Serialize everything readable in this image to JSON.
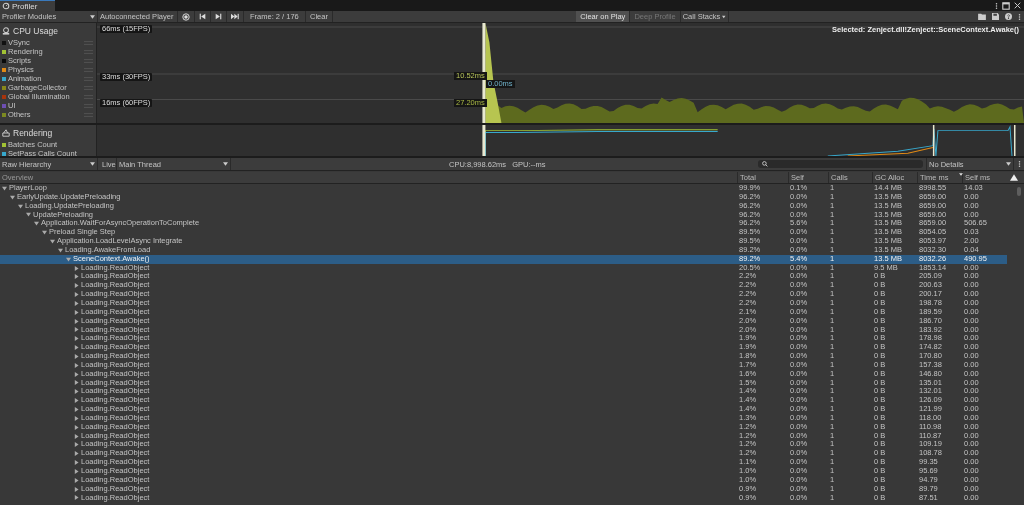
{
  "window": {
    "tab": "Profiler"
  },
  "toolbar": {
    "modules_dropdown": "Profiler Modules",
    "target": "Autoconnected Player",
    "frame": "Frame: 2 / 176",
    "clear": "Clear",
    "clear_on_play": {
      "label": "Clear on Play",
      "on": true
    },
    "deep_profile": {
      "label": "Deep Profile",
      "disabled": true
    },
    "call_stacks": "Call Stacks"
  },
  "modules": [
    {
      "title": "CPU Usage",
      "kind": "cpu",
      "legend": [
        {
          "name": "VSync",
          "color": "#111111"
        },
        {
          "name": "Rendering",
          "color": "#a1c234"
        },
        {
          "name": "Scripts",
          "color": "#0a0a0a"
        },
        {
          "name": "Physics",
          "color": "#e38a14"
        },
        {
          "name": "Animation",
          "color": "#37a8cc"
        },
        {
          "name": "GarbageCollector",
          "color": "#88881a"
        },
        {
          "name": "Global Illumination",
          "color": "#a8340c"
        },
        {
          "name": "UI",
          "color": "#6e4fb4"
        },
        {
          "name": "Others",
          "color": "#7c8a21"
        }
      ],
      "markers": [
        "66ms (15FPS)",
        "33ms (30FPS)",
        "16ms (60FPS)"
      ],
      "readings": [
        "10.52ms",
        "0.00ms",
        "27.20ms"
      ]
    },
    {
      "title": "Rendering",
      "kind": "rendering",
      "legend": [
        {
          "name": "Batches Count",
          "color": "#a1c234"
        },
        {
          "name": "SetPass Calls Count",
          "color": "#37a8cc"
        }
      ]
    }
  ],
  "selected_label": "Selected: Zenject.dll!Zenject::SceneContext.Awake()",
  "hierarchy_toolbar": {
    "view": "Raw Hierarchy",
    "live": "Live",
    "thread": "Main Thread",
    "cpu": "CPU:8,998.62ms",
    "gpu": "GPU:--ms",
    "details": "No Details"
  },
  "table": {
    "tree_column": "Overview",
    "columns": [
      "Total",
      "Self",
      "Calls",
      "GC Alloc",
      "Time ms",
      "Self ms"
    ],
    "rows": [
      {
        "name": "PlayerLoop",
        "cells": [
          "99.9%",
          "0.1%",
          "1",
          "14.4 MB",
          "8998.55",
          "14.03"
        ],
        "expanded": true,
        "selected": false,
        "children": [
          {
            "name": "EarlyUpdate.UpdatePreloading",
            "cells": [
              "96.2%",
              "0.0%",
              "1",
              "13.5 MB",
              "8659.00",
              "0.00"
            ],
            "expanded": true,
            "selected": false,
            "children": [
              {
                "name": "Loading.UpdatePreloading",
                "cells": [
                  "96.2%",
                  "0.0%",
                  "1",
                  "13.5 MB",
                  "8659.00",
                  "0.00"
                ],
                "expanded": true,
                "selected": false,
                "children": [
                  {
                    "name": "UpdatePreloading",
                    "cells": [
                      "96.2%",
                      "0.0%",
                      "1",
                      "13.5 MB",
                      "8659.00",
                      "0.00"
                    ],
                    "expanded": true,
                    "selected": false,
                    "children": [
                      {
                        "name": "Application.WaitForAsyncOperationToComplete",
                        "cells": [
                          "96.2%",
                          "5.6%",
                          "1",
                          "13.5 MB",
                          "8659.00",
                          "506.65"
                        ],
                        "expanded": true,
                        "selected": false,
                        "children": [
                          {
                            "name": "Preload Single Step",
                            "cells": [
                              "89.5%",
                              "0.0%",
                              "1",
                              "13.5 MB",
                              "8054.05",
                              "0.03"
                            ],
                            "expanded": true,
                            "selected": false,
                            "children": [
                              {
                                "name": "Application.LoadLevelAsync Integrate",
                                "cells": [
                                  "89.5%",
                                  "0.0%",
                                  "1",
                                  "13.5 MB",
                                  "8053.97",
                                  "2.00"
                                ],
                                "expanded": true,
                                "selected": false,
                                "children": [
                                  {
                                    "name": "Loading.AwakeFromLoad",
                                    "cells": [
                                      "89.2%",
                                      "0.0%",
                                      "1",
                                      "13.5 MB",
                                      "8032.30",
                                      "0.04"
                                    ],
                                    "expanded": true,
                                    "selected": false,
                                    "children": [
                                      {
                                        "name": "SceneContext.Awake()",
                                        "cells": [
                                          "89.2%",
                                          "5.4%",
                                          "1",
                                          "13.5 MB",
                                          "8032.26",
                                          "490.95"
                                        ],
                                        "expanded": true,
                                        "selected": true,
                                        "children": [
                                          {
                                            "name": "Loading.ReadObject",
                                            "cells": [
                                              "20.5%",
                                              "0.0%",
                                              "1",
                                              "9.5 MB",
                                              "1853.14",
                                              "0.00"
                                            ],
                                            "expanded": false,
                                            "selected": false
                                          },
                                          {
                                            "name": "Loading.ReadObject",
                                            "cells": [
                                              "2.2%",
                                              "0.0%",
                                              "1",
                                              "0 B",
                                              "205.09",
                                              "0.00"
                                            ],
                                            "expanded": false,
                                            "selected": false
                                          },
                                          {
                                            "name": "Loading.ReadObject",
                                            "cells": [
                                              "2.2%",
                                              "0.0%",
                                              "1",
                                              "0 B",
                                              "200.63",
                                              "0.00"
                                            ],
                                            "expanded": false,
                                            "selected": false
                                          },
                                          {
                                            "name": "Loading.ReadObject",
                                            "cells": [
                                              "2.2%",
                                              "0.0%",
                                              "1",
                                              "0 B",
                                              "200.17",
                                              "0.00"
                                            ],
                                            "expanded": false,
                                            "selected": false
                                          },
                                          {
                                            "name": "Loading.ReadObject",
                                            "cells": [
                                              "2.2%",
                                              "0.0%",
                                              "1",
                                              "0 B",
                                              "198.78",
                                              "0.00"
                                            ],
                                            "expanded": false,
                                            "selected": false
                                          },
                                          {
                                            "name": "Loading.ReadObject",
                                            "cells": [
                                              "2.1%",
                                              "0.0%",
                                              "1",
                                              "0 B",
                                              "189.59",
                                              "0.00"
                                            ],
                                            "expanded": false,
                                            "selected": false
                                          },
                                          {
                                            "name": "Loading.ReadObject",
                                            "cells": [
                                              "2.0%",
                                              "0.0%",
                                              "1",
                                              "0 B",
                                              "186.70",
                                              "0.00"
                                            ],
                                            "expanded": false,
                                            "selected": false
                                          },
                                          {
                                            "name": "Loading.ReadObject",
                                            "cells": [
                                              "2.0%",
                                              "0.0%",
                                              "1",
                                              "0 B",
                                              "183.92",
                                              "0.00"
                                            ],
                                            "expanded": false,
                                            "selected": false
                                          },
                                          {
                                            "name": "Loading.ReadObject",
                                            "cells": [
                                              "1.9%",
                                              "0.0%",
                                              "1",
                                              "0 B",
                                              "178.98",
                                              "0.00"
                                            ],
                                            "expanded": false,
                                            "selected": false
                                          },
                                          {
                                            "name": "Loading.ReadObject",
                                            "cells": [
                                              "1.9%",
                                              "0.0%",
                                              "1",
                                              "0 B",
                                              "174.82",
                                              "0.00"
                                            ],
                                            "expanded": false,
                                            "selected": false
                                          },
                                          {
                                            "name": "Loading.ReadObject",
                                            "cells": [
                                              "1.8%",
                                              "0.0%",
                                              "1",
                                              "0 B",
                                              "170.80",
                                              "0.00"
                                            ],
                                            "expanded": false,
                                            "selected": false
                                          },
                                          {
                                            "name": "Loading.ReadObject",
                                            "cells": [
                                              "1.7%",
                                              "0.0%",
                                              "1",
                                              "0 B",
                                              "157.38",
                                              "0.00"
                                            ],
                                            "expanded": false,
                                            "selected": false
                                          },
                                          {
                                            "name": "Loading.ReadObject",
                                            "cells": [
                                              "1.6%",
                                              "0.0%",
                                              "1",
                                              "0 B",
                                              "146.80",
                                              "0.00"
                                            ],
                                            "expanded": false,
                                            "selected": false
                                          },
                                          {
                                            "name": "Loading.ReadObject",
                                            "cells": [
                                              "1.5%",
                                              "0.0%",
                                              "1",
                                              "0 B",
                                              "135.01",
                                              "0.00"
                                            ],
                                            "expanded": false,
                                            "selected": false
                                          },
                                          {
                                            "name": "Loading.ReadObject",
                                            "cells": [
                                              "1.4%",
                                              "0.0%",
                                              "1",
                                              "0 B",
                                              "132.01",
                                              "0.00"
                                            ],
                                            "expanded": false,
                                            "selected": false
                                          },
                                          {
                                            "name": "Loading.ReadObject",
                                            "cells": [
                                              "1.4%",
                                              "0.0%",
                                              "1",
                                              "0 B",
                                              "126.09",
                                              "0.00"
                                            ],
                                            "expanded": false,
                                            "selected": false
                                          },
                                          {
                                            "name": "Loading.ReadObject",
                                            "cells": [
                                              "1.4%",
                                              "0.0%",
                                              "1",
                                              "0 B",
                                              "121.99",
                                              "0.00"
                                            ],
                                            "expanded": false,
                                            "selected": false
                                          },
                                          {
                                            "name": "Loading.ReadObject",
                                            "cells": [
                                              "1.3%",
                                              "0.0%",
                                              "1",
                                              "0 B",
                                              "118.00",
                                              "0.00"
                                            ],
                                            "expanded": false,
                                            "selected": false
                                          },
                                          {
                                            "name": "Loading.ReadObject",
                                            "cells": [
                                              "1.2%",
                                              "0.0%",
                                              "1",
                                              "0 B",
                                              "110.98",
                                              "0.00"
                                            ],
                                            "expanded": false,
                                            "selected": false
                                          },
                                          {
                                            "name": "Loading.ReadObject",
                                            "cells": [
                                              "1.2%",
                                              "0.0%",
                                              "1",
                                              "0 B",
                                              "110.87",
                                              "0.00"
                                            ],
                                            "expanded": false,
                                            "selected": false
                                          },
                                          {
                                            "name": "Loading.ReadObject",
                                            "cells": [
                                              "1.2%",
                                              "0.0%",
                                              "1",
                                              "0 B",
                                              "109.19",
                                              "0.00"
                                            ],
                                            "expanded": false,
                                            "selected": false
                                          },
                                          {
                                            "name": "Loading.ReadObject",
                                            "cells": [
                                              "1.2%",
                                              "0.0%",
                                              "1",
                                              "0 B",
                                              "108.78",
                                              "0.00"
                                            ],
                                            "expanded": false,
                                            "selected": false
                                          },
                                          {
                                            "name": "Loading.ReadObject",
                                            "cells": [
                                              "1.1%",
                                              "0.0%",
                                              "1",
                                              "0 B",
                                              "99.35",
                                              "0.00"
                                            ],
                                            "expanded": false,
                                            "selected": false
                                          },
                                          {
                                            "name": "Loading.ReadObject",
                                            "cells": [
                                              "1.0%",
                                              "0.0%",
                                              "1",
                                              "0 B",
                                              "95.69",
                                              "0.00"
                                            ],
                                            "expanded": false,
                                            "selected": false
                                          },
                                          {
                                            "name": "Loading.ReadObject",
                                            "cells": [
                                              "1.0%",
                                              "0.0%",
                                              "1",
                                              "0 B",
                                              "94.79",
                                              "0.00"
                                            ],
                                            "expanded": false,
                                            "selected": false
                                          },
                                          {
                                            "name": "Loading.ReadObject",
                                            "cells": [
                                              "0.9%",
                                              "0.0%",
                                              "1",
                                              "0 B",
                                              "89.79",
                                              "0.00"
                                            ],
                                            "expanded": false,
                                            "selected": false
                                          },
                                          {
                                            "name": "Loading.ReadObject",
                                            "cells": [
                                              "0.9%",
                                              "0.0%",
                                              "1",
                                              "0 B",
                                              "87.51",
                                              "0.00"
                                            ],
                                            "expanded": false,
                                            "selected": false
                                          }
                                        ]
                                      }
                                    ]
                                  }
                                ]
                              }
                            ]
                          }
                        ]
                      }
                    ]
                  }
                ]
              }
            ]
          }
        ]
      }
    ]
  }
}
